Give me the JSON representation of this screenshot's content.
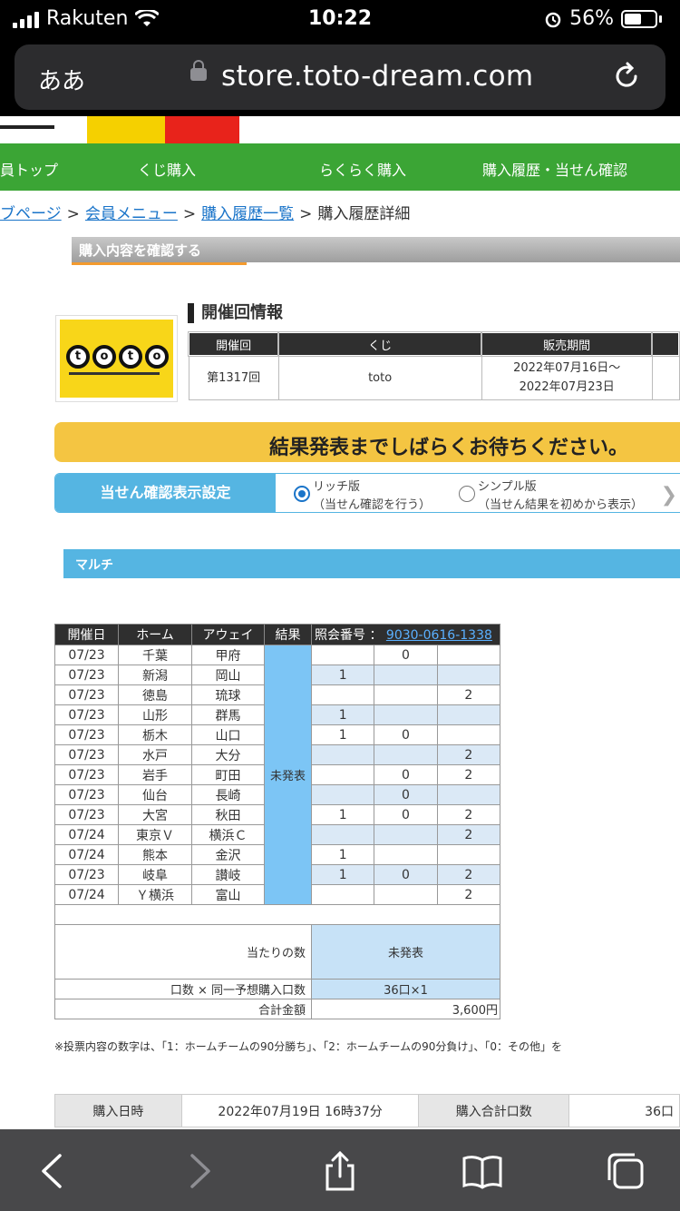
{
  "status_bar": {
    "carrier": "Rakuten",
    "time": "10:22",
    "battery": "56%"
  },
  "browser": {
    "text_size_label": "ああ",
    "url": "store.toto-dream.com"
  },
  "nav": {
    "items": [
      "員トップ",
      "くじ購入",
      "らくらく購入",
      "購入履歴・当せん確認"
    ]
  },
  "breadcrumb": {
    "items": [
      "ブページ",
      "会員メニュー",
      "購入履歴一覧"
    ],
    "current": "購入履歴詳細",
    "separator": ">"
  },
  "confirm_title": "購入内容を確認する",
  "logo": {
    "letters": [
      "t",
      "o",
      "t",
      "o"
    ]
  },
  "round_info": {
    "title": "開催回情報",
    "headers": [
      "開催回",
      "くじ",
      "販売期間"
    ],
    "round": "第1317回",
    "lottery": "toto",
    "period_start": "2022年07月16日〜",
    "period_end": "2022年07月23日"
  },
  "wait_message": "結果発表までしばらくお待ちください。",
  "display_setting": {
    "label": "当せん確認表示設定",
    "rich_title": "リッチ版",
    "rich_desc": "（当せん確認を行う）",
    "simple_title": "シンプル版",
    "simple_desc": "（当せん結果を初めから表示）",
    "selected": "rich"
  },
  "bet_type": "マルチ",
  "picks": {
    "headers": {
      "date": "開催日",
      "home": "ホーム",
      "away": "アウェイ",
      "result": "結果",
      "ref_label": "照会番号 ：",
      "ref_number": "9030-0616-1338"
    },
    "result_status": "未発表",
    "rows": [
      {
        "date": "07/23",
        "home": "千葉",
        "away": "甲府",
        "p1": "",
        "p0": "0",
        "p2": ""
      },
      {
        "date": "07/23",
        "home": "新潟",
        "away": "岡山",
        "p1": "1",
        "p0": "",
        "p2": ""
      },
      {
        "date": "07/23",
        "home": "徳島",
        "away": "琉球",
        "p1": "",
        "p0": "",
        "p2": "2"
      },
      {
        "date": "07/23",
        "home": "山形",
        "away": "群馬",
        "p1": "1",
        "p0": "",
        "p2": ""
      },
      {
        "date": "07/23",
        "home": "栃木",
        "away": "山口",
        "p1": "1",
        "p0": "0",
        "p2": ""
      },
      {
        "date": "07/23",
        "home": "水戸",
        "away": "大分",
        "p1": "",
        "p0": "",
        "p2": "2"
      },
      {
        "date": "07/23",
        "home": "岩手",
        "away": "町田",
        "p1": "",
        "p0": "0",
        "p2": "2"
      },
      {
        "date": "07/23",
        "home": "仙台",
        "away": "長崎",
        "p1": "",
        "p0": "0",
        "p2": ""
      },
      {
        "date": "07/23",
        "home": "大宮",
        "away": "秋田",
        "p1": "1",
        "p0": "0",
        "p2": "2"
      },
      {
        "date": "07/24",
        "home": "東京Ｖ",
        "away": "横浜Ｃ",
        "p1": "",
        "p0": "",
        "p2": "2"
      },
      {
        "date": "07/24",
        "home": "熊本",
        "away": "金沢",
        "p1": "1",
        "p0": "",
        "p2": ""
      },
      {
        "date": "07/23",
        "home": "岐阜",
        "away": "讃岐",
        "p1": "1",
        "p0": "0",
        "p2": "2"
      },
      {
        "date": "07/24",
        "home": "Ｙ横浜",
        "away": "富山",
        "p1": "",
        "p0": "",
        "p2": "2"
      }
    ],
    "hits_label": "当たりの数",
    "hits_value": "未発表",
    "units_label": "口数 × 同一予想購入口数",
    "units_value": "36口×1",
    "total_label": "合計金額",
    "total_value": "3,600円"
  },
  "footnote": "※投票内容の数字は、「1：ホームチームの90分勝ち」、「2：ホームチームの90分負け」、「0：その他」を",
  "purchase": {
    "date_label": "購入日時",
    "date_value": "2022年07月19日 16時37分",
    "units_label": "購入合計口数",
    "units_value": "36口"
  },
  "colors": {
    "nav_green": "#3ba535",
    "accent_blue": "#55b5e2",
    "wait_yellow": "#f4c542",
    "result_blue": "#7cc5f5"
  }
}
